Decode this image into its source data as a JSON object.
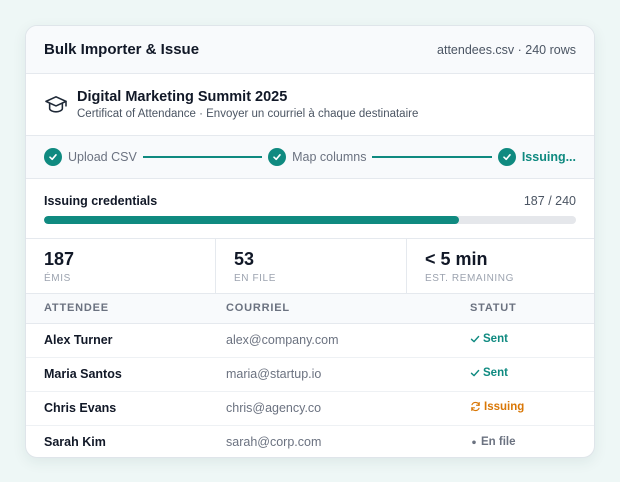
{
  "header": {
    "title": "Bulk Importer & Issue",
    "meta": "attendees.csv · 240 rows"
  },
  "event": {
    "icon": "graduation-cap-icon",
    "title": "Digital Marketing Summit 2025",
    "subtitle": "Certificat of Attendance · Envoyer un courriel à chaque destinataire"
  },
  "steps": [
    {
      "label": "Upload CSV",
      "state": "done"
    },
    {
      "label": "Map columns",
      "state": "done"
    },
    {
      "label": "Issuing...",
      "state": "active"
    }
  ],
  "progress": {
    "label": "Issuing credentials",
    "count_text": "187 / 240",
    "done": 187,
    "total": 240
  },
  "stats": [
    {
      "value": "187",
      "label": "ÉMIS"
    },
    {
      "value": "53",
      "label": "EN FILE"
    },
    {
      "value": "< 5 min",
      "label": "EST. REMAINING"
    }
  ],
  "table": {
    "headers": [
      "ATTENDEE",
      "COURRIEL",
      "STATUT"
    ],
    "rows": [
      {
        "name": "Alex Turner",
        "email": "alex@company.com",
        "status": "Sent",
        "status_type": "sent"
      },
      {
        "name": "Maria Santos",
        "email": "maria@startup.io",
        "status": "Sent",
        "status_type": "sent"
      },
      {
        "name": "Chris Evans",
        "email": "chris@agency.co",
        "status": "Issuing",
        "status_type": "issuing"
      },
      {
        "name": "Sarah Kim",
        "email": "sarah@corp.com",
        "status": "En file",
        "status_type": "queued"
      }
    ]
  },
  "colors": {
    "accent": "#0f8a80",
    "warning": "#d97706",
    "muted": "#6b7280"
  }
}
